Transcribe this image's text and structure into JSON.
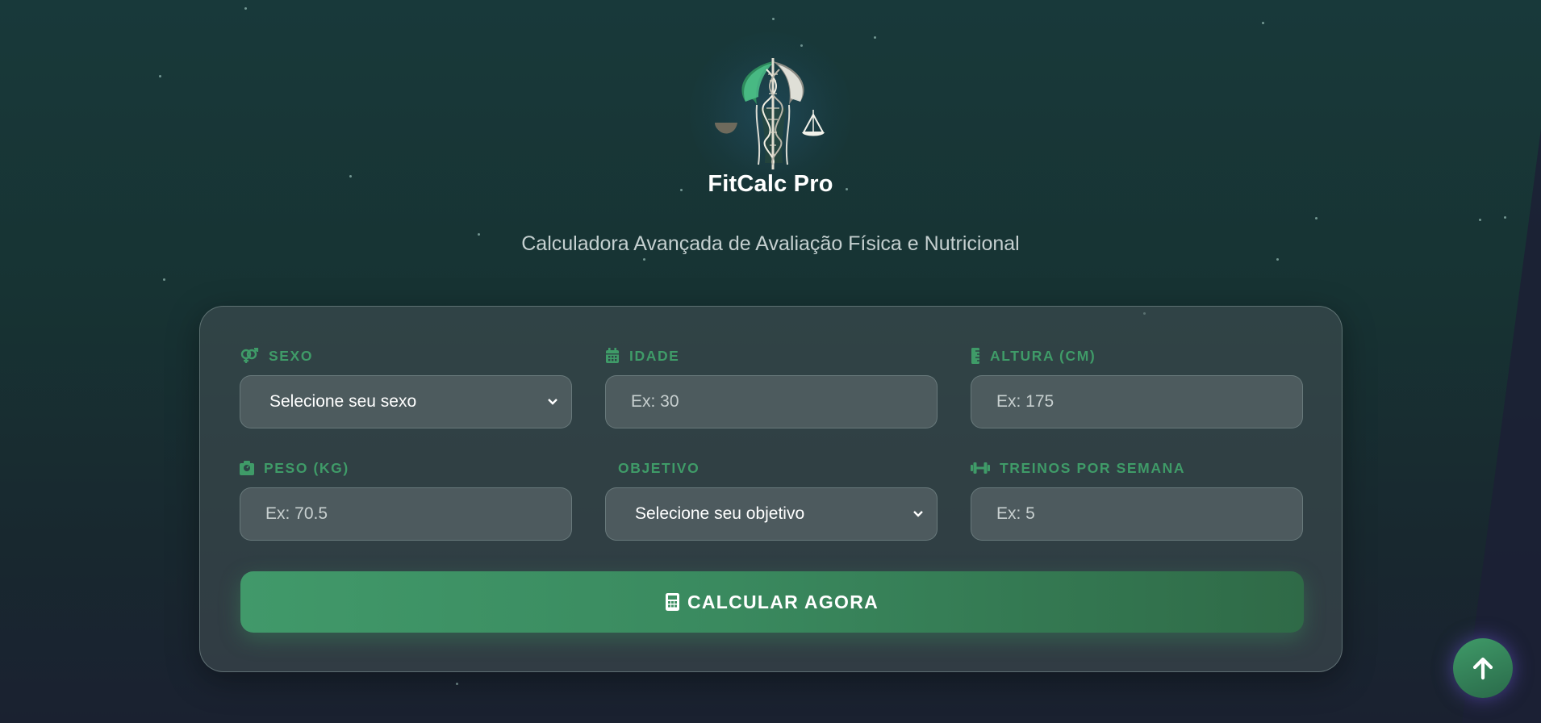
{
  "app": {
    "brand": "FitCalc Pro",
    "subtitle": "Calculadora Avançada de Avaliação Física e Nutricional"
  },
  "form": {
    "sexo": {
      "label": "SEXO",
      "value": "Selecione seu sexo",
      "icon": "gender-icon"
    },
    "idade": {
      "label": "IDADE",
      "placeholder": "Ex: 30",
      "icon": "calendar-icon"
    },
    "altura": {
      "label": "ALTURA (CM)",
      "placeholder": "Ex: 175",
      "icon": "ruler-icon"
    },
    "peso": {
      "label": "PESO (KG)",
      "placeholder": "Ex: 70.5",
      "icon": "weight-icon"
    },
    "objetivo": {
      "label": "OBJETIVO",
      "value": "Selecione seu objetivo"
    },
    "treinos": {
      "label": "TREINOS POR SEMANA",
      "placeholder": "Ex: 5",
      "icon": "dumbbell-icon"
    },
    "submit": {
      "label": "CALCULAR AGORA",
      "icon": "calculator-icon"
    }
  },
  "scroll_top": {
    "icon": "arrow-up-icon"
  },
  "colors": {
    "accent": "#41996a",
    "label_green": "#3f9b68",
    "background": "#173333"
  }
}
